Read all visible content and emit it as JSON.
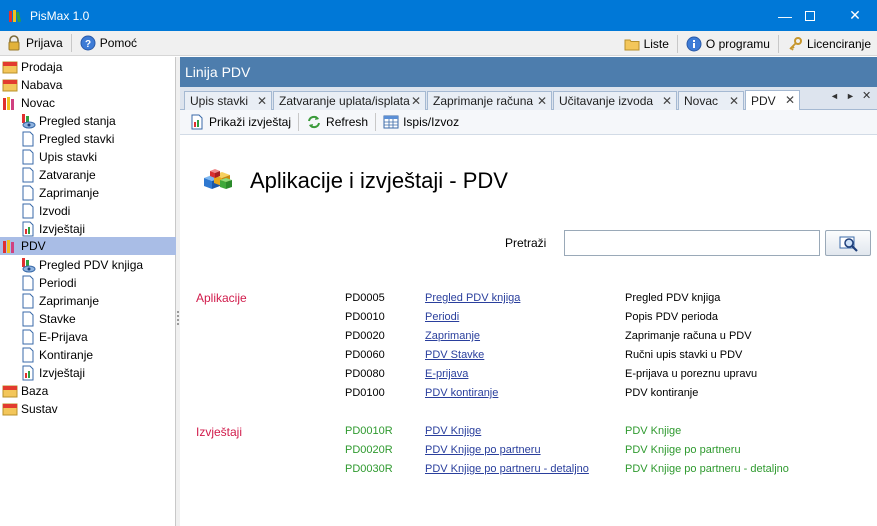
{
  "app": {
    "title": "PisMax 1.0"
  },
  "window_controls": {
    "minimize": "—",
    "maximize": "☐",
    "close": "✕"
  },
  "menubar": {
    "left": [
      {
        "label": "Prijava",
        "icon": "lock-icon"
      },
      {
        "label": "Pomoć",
        "icon": "help-icon"
      }
    ],
    "right": [
      {
        "label": "Liste",
        "icon": "folder-icon"
      },
      {
        "label": "O programu",
        "icon": "info-icon"
      },
      {
        "label": "Licenciranje",
        "icon": "key-icon"
      }
    ]
  },
  "tree": [
    {
      "label": "Prodaja",
      "level": 0,
      "icon": "cabinet-icon"
    },
    {
      "label": "Nabava",
      "level": 0,
      "icon": "cabinet-icon"
    },
    {
      "label": "Novac",
      "level": 0,
      "icon": "books-icon"
    },
    {
      "label": "Pregled stanja",
      "level": 1,
      "icon": "report-view-icon"
    },
    {
      "label": "Pregled stavki",
      "level": 1,
      "icon": "document-icon"
    },
    {
      "label": "Upis stavki",
      "level": 1,
      "icon": "document-icon"
    },
    {
      "label": "Zatvaranje",
      "level": 1,
      "icon": "document-icon"
    },
    {
      "label": "Zaprimanje",
      "level": 1,
      "icon": "document-icon"
    },
    {
      "label": "Izvodi",
      "level": 1,
      "icon": "document-icon"
    },
    {
      "label": "Izvještaji",
      "level": 1,
      "icon": "report-icon"
    },
    {
      "label": "PDV",
      "level": 0,
      "icon": "books-icon",
      "selected": true
    },
    {
      "label": "Pregled PDV knjiga",
      "level": 1,
      "icon": "report-view-icon"
    },
    {
      "label": "Periodi",
      "level": 1,
      "icon": "document-icon"
    },
    {
      "label": "Zaprimanje",
      "level": 1,
      "icon": "document-icon"
    },
    {
      "label": "Stavke",
      "level": 1,
      "icon": "document-icon"
    },
    {
      "label": "E-Prijava",
      "level": 1,
      "icon": "document-icon"
    },
    {
      "label": "Kontiranje",
      "level": 1,
      "icon": "document-icon"
    },
    {
      "label": "Izvještaji",
      "level": 1,
      "icon": "report-icon"
    },
    {
      "label": "Baza",
      "level": 0,
      "icon": "cabinet-icon"
    },
    {
      "label": "Sustav",
      "level": 0,
      "icon": "cabinet-icon"
    }
  ],
  "panel": {
    "title": "Linija PDV"
  },
  "tabs": [
    {
      "label": "Upis stavki"
    },
    {
      "label": "Zatvaranje uplata/isplata"
    },
    {
      "label": "Zaprimanje računa"
    },
    {
      "label": "Učitavanje izvoda"
    },
    {
      "label": "Novac"
    },
    {
      "label": "PDV",
      "active": true
    }
  ],
  "tab_nav": {
    "prev": "◄",
    "next": "►",
    "close": "✕"
  },
  "subtoolbar": [
    {
      "label": "Prikaži izvještaj",
      "icon": "report-show-icon"
    },
    {
      "label": "Refresh",
      "icon": "refresh-icon"
    },
    {
      "label": "Ispis/Izvoz",
      "icon": "table-export-icon"
    }
  ],
  "main": {
    "heading": "Aplikacije i izvještaji - PDV",
    "search_label": "Pretraži",
    "search_value": ""
  },
  "aplikacije": {
    "label": "Aplikacije",
    "rows": [
      {
        "code": "PD0005",
        "link": "Pregled PDV knjiga",
        "desc": "Pregled PDV knjiga"
      },
      {
        "code": "PD0010",
        "link": "Periodi",
        "desc": "Popis PDV perioda"
      },
      {
        "code": "PD0020",
        "link": "Zaprimanje",
        "desc": "Zaprimanje računa u PDV"
      },
      {
        "code": "PD0060",
        "link": "PDV Stavke",
        "desc": "Ručni upis stavki u PDV"
      },
      {
        "code": "PD0080",
        "link": "E-prijava",
        "desc": "E-prijava u poreznu upravu"
      },
      {
        "code": "PD0100",
        "link": "PDV kontiranje",
        "desc": "PDV kontiranje"
      }
    ]
  },
  "izvjestaji": {
    "label": "Izvještaji",
    "rows": [
      {
        "code": "PD0010R",
        "link": "PDV Knjige",
        "desc": "PDV Knjige"
      },
      {
        "code": "PD0020R",
        "link": "PDV Knjige po partneru",
        "desc": "PDV Knjige po partneru"
      },
      {
        "code": "PD0030R",
        "link": "PDV Knjige po partneru - detaljno",
        "desc": "PDV Knjige po partneru - detaljno"
      }
    ]
  },
  "colors": {
    "titlebar": "#0078d7",
    "panel_header": "#4d7dad",
    "section_label": "#d11b4b",
    "report_green": "#2f9a2f",
    "tree_selected": "#a9bde6"
  }
}
